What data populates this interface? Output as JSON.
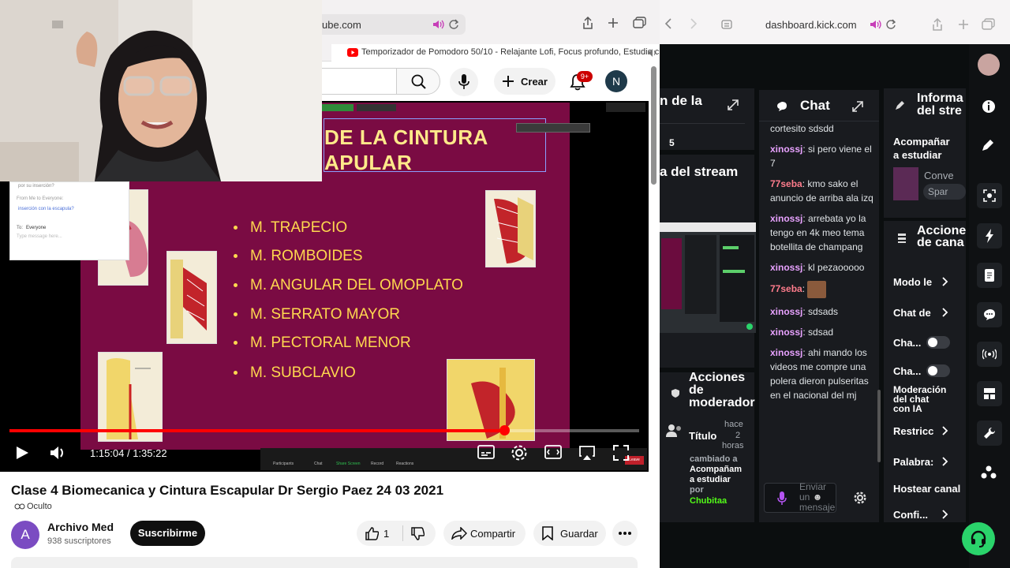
{
  "left_browser": {
    "url": "ube.com",
    "tab_title": "Temporizador de Pomodoro 50/10 - Relajante Lofi, Focus profundo, Estudio c...",
    "header": {
      "create_label": "Crear",
      "notif_badge": "9+",
      "avatar_letter": "N"
    },
    "video": {
      "slide": {
        "title_line1": "DE LA CINTURA",
        "title_line2": "APULAR",
        "bullets": [
          "M. TRAPECIO",
          "M. ROMBOIDES",
          "M. ANGULAR DEL OMOPLATO",
          "M. SERRATO MAYOR",
          "M. PECTORAL MENOR",
          "M. SUBCLAVIO"
        ]
      },
      "zoom_chat": {
        "line1": "por su inserción?",
        "line2": "From Me to Everyone:",
        "line3": "inserción con la escapula?",
        "to_label": "To:",
        "to_value": "Everyone",
        "placeholder": "Type message here..."
      },
      "zoom_controls": [
        "Participants",
        "Chat",
        "Share Screen",
        "Record",
        "Reactions",
        "Leave"
      ],
      "time_display": "1:15:04 / 1:35:22",
      "progress": 0.786
    },
    "meta": {
      "title": "Clase 4 Biomecanica y Cintura Escapular Dr Sergio Paez 24 03 2021",
      "visibility": "Oculto",
      "channel_name": "Archivo Med",
      "channel_letter": "A",
      "subscribers": "938 suscriptores",
      "subscribe_label": "Suscribirme",
      "likes": "1",
      "share_label": "Compartir",
      "save_label": "Guardar"
    }
  },
  "right_browser": {
    "url": "dashboard.kick.com",
    "panels": {
      "panel1_title": "n de la",
      "panel1_value": "5",
      "panel2_title": "a del stream",
      "info_title_1": "Informa",
      "info_title_2": "del stre",
      "info_item_1": "Acompañar",
      "info_item_2": "a estudiar",
      "info_conv": "Conve",
      "info_spar": "Spar",
      "channel_actions_1": "Accione",
      "channel_actions_2": "de cana",
      "mod_actions_1": "Acciones",
      "mod_actions_2": "de",
      "mod_actions_3": "moderador",
      "mod_title_label": "Título",
      "mod_time_1": "hace",
      "mod_time_2": "2",
      "mod_time_3": "horas",
      "mod_changed_1": "cambiado a",
      "mod_changed_2": "Acompañam",
      "mod_changed_3": "a estudiar",
      "mod_by": "por",
      "mod_user": "Chubitaa"
    },
    "chat": {
      "title": "Chat",
      "messages": [
        {
          "user": "",
          "text": "cortesito sdsdd"
        },
        {
          "user": "xinossj",
          "text": "si pero viene el 7"
        },
        {
          "user": "77seba",
          "text": "kmo sako el anuncio de arriba ala izq"
        },
        {
          "user": "xinossj",
          "text": "arrebata yo la tengo en 4k meo tema botellita de champang"
        },
        {
          "user": "xinossj",
          "text": "kl pezaooooo"
        },
        {
          "user": "77seba",
          "text": ""
        },
        {
          "user": "xinossj",
          "text": "sdsads"
        },
        {
          "user": "xinossj",
          "text": "sdsad"
        },
        {
          "user": "xinossj",
          "text": "ahi mando los videos me compre una polera dieron pulseritas en el nacional del mj"
        }
      ],
      "input_placeholder_1": "Enviar",
      "input_placeholder_2": "un",
      "input_placeholder_3": "mensaje"
    },
    "settings": {
      "modo": "Modo le",
      "chat_de": "Chat de",
      "cha1": "Cha...",
      "cha2": "Cha...",
      "moderacion_1": "Moderación",
      "moderacion_2": "del chat",
      "moderacion_3": "con IA",
      "restric": "Restricc",
      "palabras": "Palabra:",
      "hostear": "Hostear canal",
      "confi": "Confi..."
    }
  },
  "colors": {
    "youtube_red": "#ff0000",
    "slide_bg": "#7a0b43",
    "slide_text": "#ffd84f",
    "kick_green": "#2ad46b",
    "kick_panel": "#191b1f"
  }
}
